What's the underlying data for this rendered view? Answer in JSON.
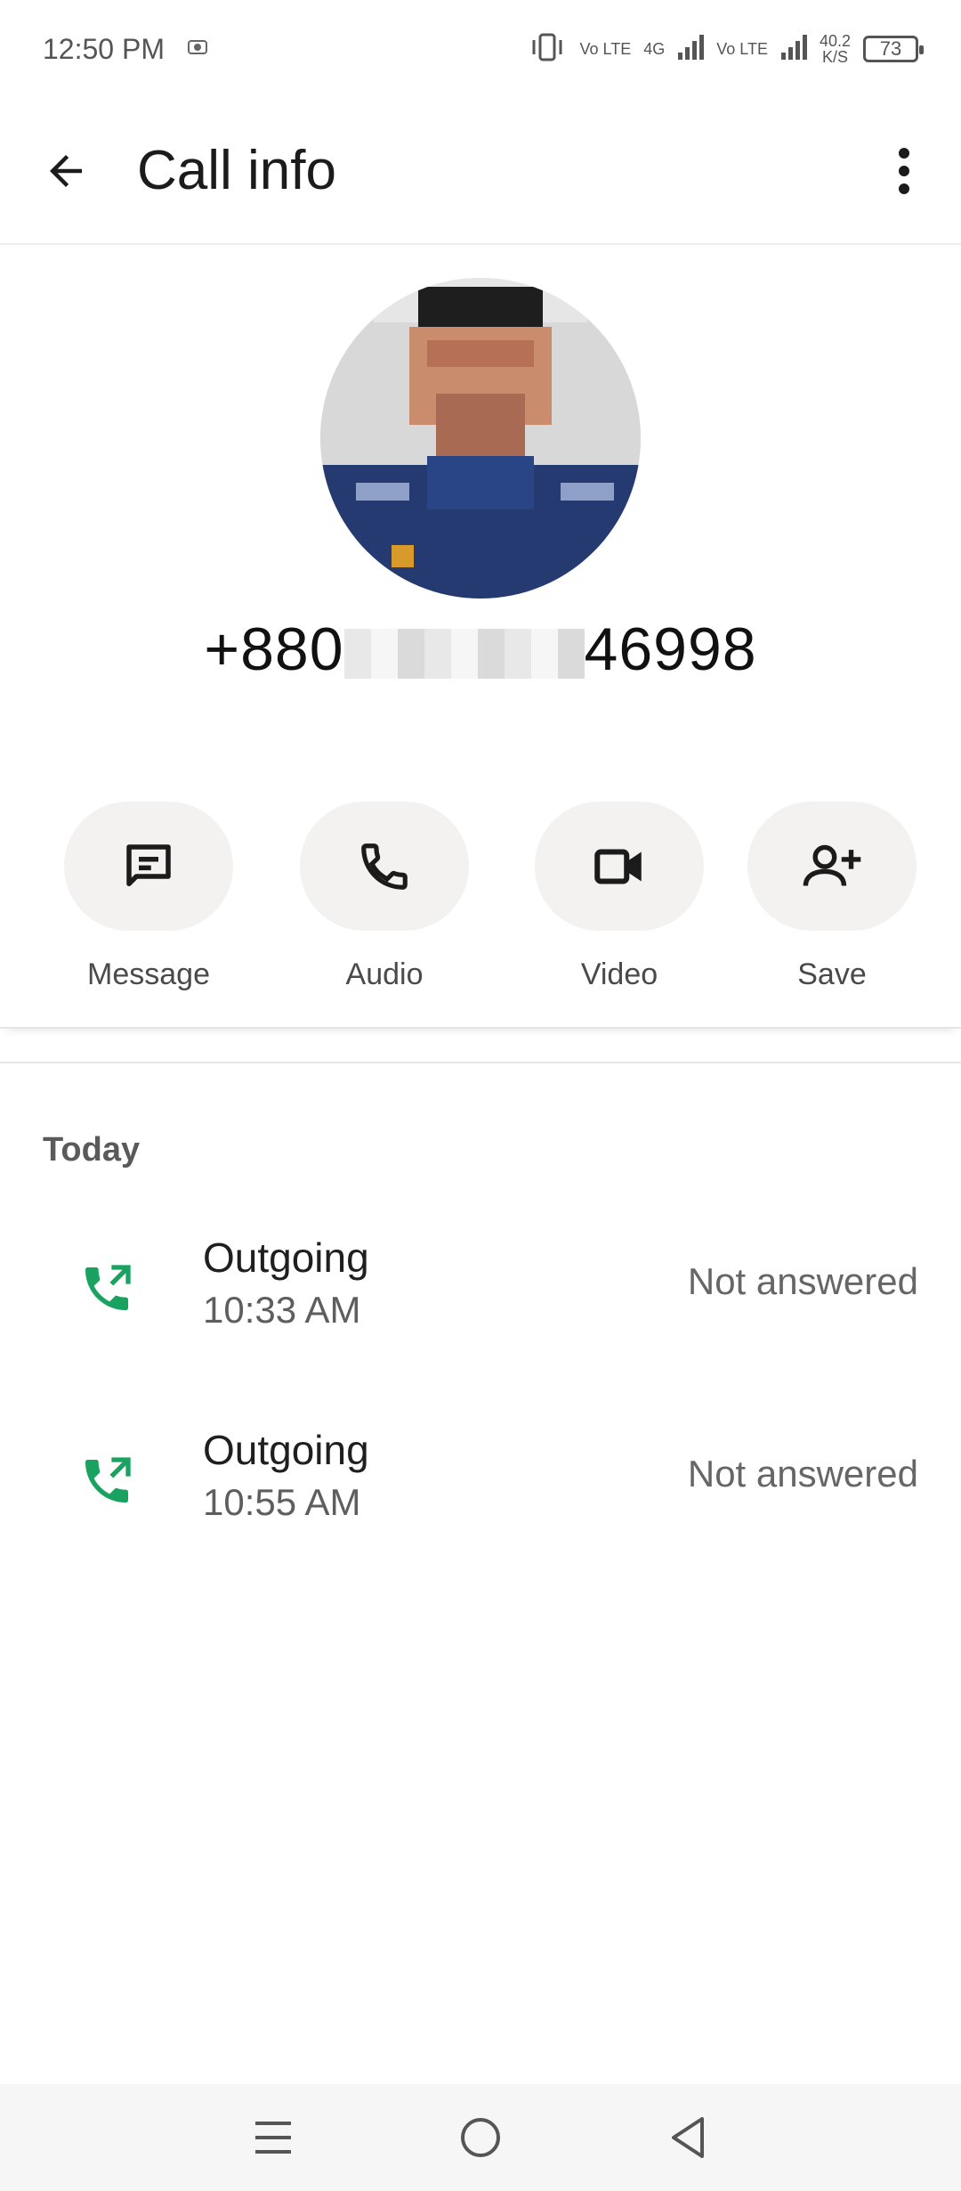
{
  "status_bar": {
    "time": "12:50 PM",
    "volte1": "Vo LTE",
    "net": "4G",
    "volte2": "Vo LTE",
    "speed_value": "40.2",
    "speed_unit": "K/S",
    "battery": "73"
  },
  "app_bar": {
    "title": "Call info"
  },
  "contact": {
    "phone_prefix": "+880",
    "phone_suffix": "46998"
  },
  "actions": [
    {
      "label": "Message",
      "icon": "message-icon"
    },
    {
      "label": "Audio",
      "icon": "phone-icon"
    },
    {
      "label": "Video",
      "icon": "video-icon"
    },
    {
      "label": "Save",
      "icon": "add-person-icon"
    }
  ],
  "history": {
    "section": "Today",
    "calls": [
      {
        "type": "Outgoing",
        "time": "10:33 AM",
        "status": "Not answered"
      },
      {
        "type": "Outgoing",
        "time": "10:55 AM",
        "status": "Not answered"
      }
    ]
  },
  "colors": {
    "accent_green": "#1aa260",
    "pill_bg": "#f3f2f1"
  }
}
